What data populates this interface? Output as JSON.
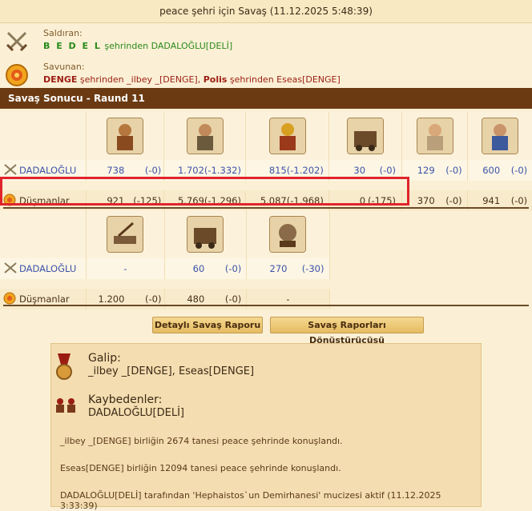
{
  "header": {
    "title": "peace şehri için Savaş (11.12.2025 5:48:39)"
  },
  "attacker": {
    "label": "Saldıran:",
    "player": "B E D E L",
    "rest": " şehrinden DADALOĞLU[DELİ]"
  },
  "defender": {
    "label": "Savunan:",
    "player1": "DENGE",
    "mid1": " şehrinden _ilbey _[DENGE], ",
    "player2": "Polis",
    "mid2": " şehrinden Eseas[DENGE]"
  },
  "result_bar": {
    "title": "Savaş Sonucu - Raund 11"
  },
  "table1": {
    "attacker_name": "DADALOĞLU",
    "defender_name": "Düşmanlar",
    "attacker_row": [
      [
        "738",
        "(-0)"
      ],
      [
        "1.702",
        "(-1.332)"
      ],
      [
        "815",
        "(-1.202)"
      ],
      [
        "30",
        "(-0)"
      ],
      [
        "129",
        "(-0)"
      ],
      [
        "600",
        "(-0)"
      ]
    ],
    "defender_row": [
      [
        "921",
        "(-125)"
      ],
      [
        "5.769",
        "(-1.296)"
      ],
      [
        "5.087",
        "(-1.968)"
      ],
      [
        "0",
        "(-175)"
      ],
      [
        "370",
        "(-0)"
      ],
      [
        "941",
        "(-0)"
      ]
    ]
  },
  "table2": {
    "attacker_name": "DADALOĞLU",
    "defender_name": "Düşmanlar",
    "attacker_row": [
      [
        "-",
        ""
      ],
      [
        "60",
        "(-0)"
      ],
      [
        "270",
        "(-30)"
      ]
    ],
    "defender_row": [
      [
        "1.200",
        "(-0)"
      ],
      [
        "480",
        "(-0)"
      ],
      [
        "-",
        ""
      ]
    ]
  },
  "buttons": {
    "detailed": "Detaylı Savaş Raporu",
    "converter": "Savaş Raporları Dönüştürücüsü"
  },
  "summary": {
    "winner_label": "Galip:",
    "winner_value": "_ilbey _[DENGE], Eseas[DENGE]",
    "loser_label": "Kaybedenler:",
    "loser_value": "DADALOĞLU[DELİ]",
    "messages": [
      "_ilbey _[DENGE] birliğin 2674 tanesi peace şehrinde konuşlandı.",
      "Eseas[DENGE] birliğin 12094 tanesi peace şehrinde konuşlandı.",
      "DADALOĞLU[DELİ] tarafından 'Hephaistos`un Demirhanesi' mucizesi aktif (11.12.2025 3:33:39)"
    ]
  }
}
